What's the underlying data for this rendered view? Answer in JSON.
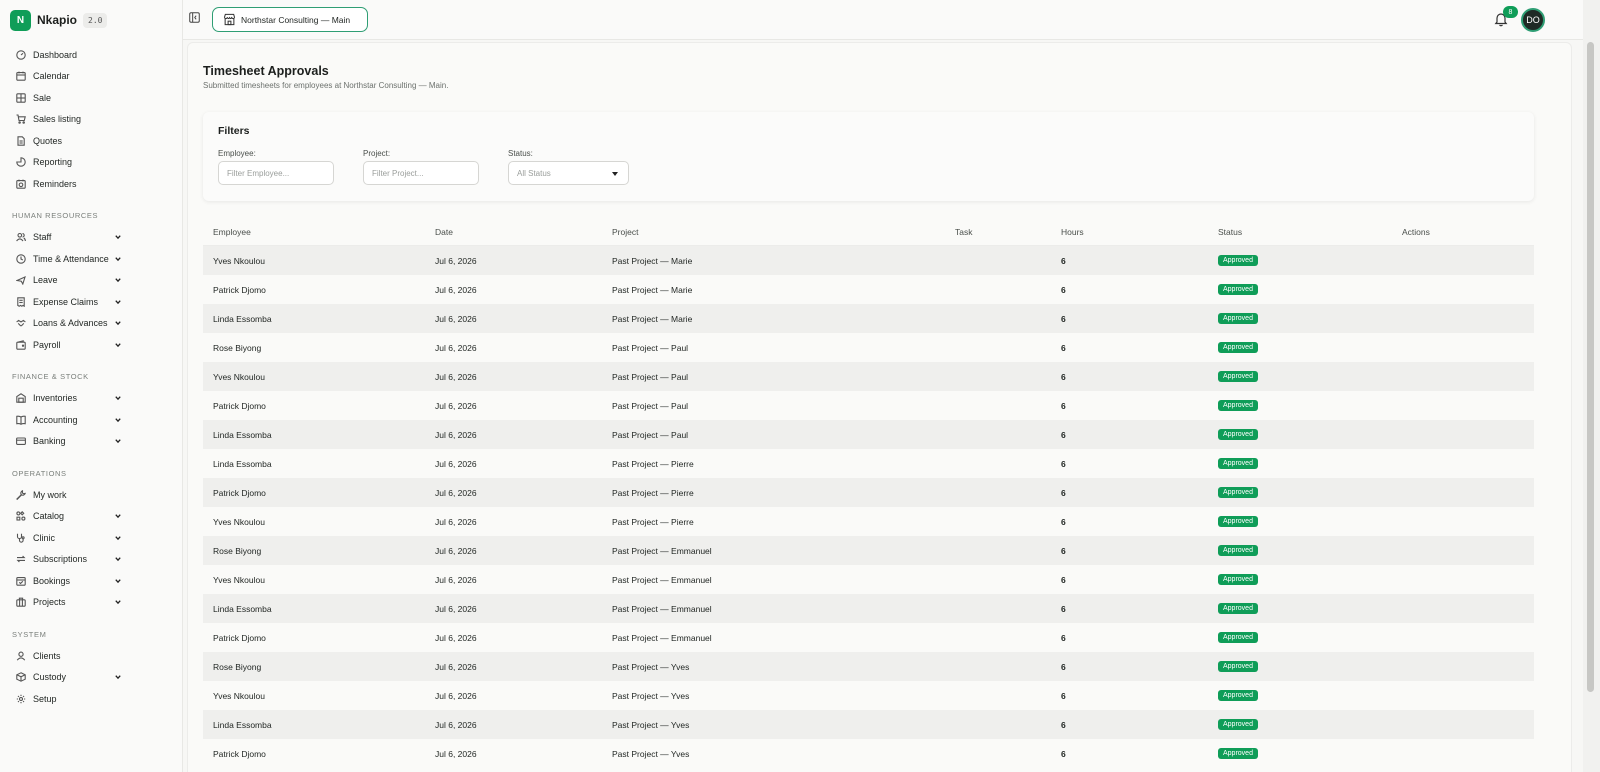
{
  "brand": {
    "logo_letter": "N",
    "name": "Nkapio",
    "version": "2.0"
  },
  "sidebar": {
    "top_items": [
      {
        "label": "Dashboard",
        "icon": "dashboard-icon"
      },
      {
        "label": "Calendar",
        "icon": "calendar-icon"
      },
      {
        "label": "Sale",
        "icon": "grid-icon"
      },
      {
        "label": "Sales listing",
        "icon": "cart-icon"
      },
      {
        "label": "Quotes",
        "icon": "document-icon"
      },
      {
        "label": "Reporting",
        "icon": "pie-chart-icon"
      },
      {
        "label": "Reminders",
        "icon": "reminder-icon"
      }
    ],
    "sections": [
      {
        "title": "HUMAN RESOURCES",
        "items": [
          {
            "label": "Staff",
            "icon": "users-icon"
          },
          {
            "label": "Time & Attendance",
            "icon": "clock-icon"
          },
          {
            "label": "Leave",
            "icon": "plane-icon"
          },
          {
            "label": "Expense Claims",
            "icon": "receipt-icon"
          },
          {
            "label": "Loans & Advances",
            "icon": "handshake-icon"
          },
          {
            "label": "Payroll",
            "icon": "wallet-icon"
          }
        ]
      },
      {
        "title": "FINANCE & STOCK",
        "items": [
          {
            "label": "Inventories",
            "icon": "warehouse-icon"
          },
          {
            "label": "Accounting",
            "icon": "book-icon"
          },
          {
            "label": "Banking",
            "icon": "bank-card-icon"
          }
        ]
      },
      {
        "title": "OPERATIONS",
        "items": [
          {
            "label": "My work",
            "icon": "wrench-icon"
          },
          {
            "label": "Catalog",
            "icon": "catalog-icon"
          },
          {
            "label": "Clinic",
            "icon": "stethoscope-icon"
          },
          {
            "label": "Subscriptions",
            "icon": "repeat-icon"
          },
          {
            "label": "Bookings",
            "icon": "booking-icon"
          },
          {
            "label": "Projects",
            "icon": "briefcase-icon"
          }
        ]
      },
      {
        "title": "SYSTEM",
        "items": [
          {
            "label": "Clients",
            "icon": "user-icon"
          },
          {
            "label": "Custody",
            "icon": "box-icon"
          },
          {
            "label": "Setup",
            "icon": "gear-icon"
          }
        ]
      }
    ]
  },
  "topbar": {
    "org_label": "Northstar Consulting — Main",
    "notification_count": "8",
    "avatar_initials": "DO"
  },
  "page": {
    "title": "Timesheet Approvals",
    "subtitle": "Submitted timesheets for employees at Northstar Consulting — Main."
  },
  "filters": {
    "title": "Filters",
    "employee_label": "Employee:",
    "employee_placeholder": "Filter Employee...",
    "project_label": "Project:",
    "project_placeholder": "Filter Project...",
    "status_label": "Status:",
    "status_value": "All Status"
  },
  "table": {
    "columns": [
      "Employee",
      "Date",
      "Project",
      "Task",
      "Hours",
      "Status",
      "Actions"
    ],
    "rows": [
      {
        "employee": "Yves Nkoulou",
        "date": "Jul 6, 2026",
        "project": "Past Project — Marie",
        "task": "",
        "hours": "6",
        "status": "Approved"
      },
      {
        "employee": "Patrick Djomo",
        "date": "Jul 6, 2026",
        "project": "Past Project — Marie",
        "task": "",
        "hours": "6",
        "status": "Approved"
      },
      {
        "employee": "Linda Essomba",
        "date": "Jul 6, 2026",
        "project": "Past Project — Marie",
        "task": "",
        "hours": "6",
        "status": "Approved"
      },
      {
        "employee": "Rose Biyong",
        "date": "Jul 6, 2026",
        "project": "Past Project — Paul",
        "task": "",
        "hours": "6",
        "status": "Approved"
      },
      {
        "employee": "Yves Nkoulou",
        "date": "Jul 6, 2026",
        "project": "Past Project — Paul",
        "task": "",
        "hours": "6",
        "status": "Approved"
      },
      {
        "employee": "Patrick Djomo",
        "date": "Jul 6, 2026",
        "project": "Past Project — Paul",
        "task": "",
        "hours": "6",
        "status": "Approved"
      },
      {
        "employee": "Linda Essomba",
        "date": "Jul 6, 2026",
        "project": "Past Project — Paul",
        "task": "",
        "hours": "6",
        "status": "Approved"
      },
      {
        "employee": "Linda Essomba",
        "date": "Jul 6, 2026",
        "project": "Past Project — Pierre",
        "task": "",
        "hours": "6",
        "status": "Approved"
      },
      {
        "employee": "Patrick Djomo",
        "date": "Jul 6, 2026",
        "project": "Past Project — Pierre",
        "task": "",
        "hours": "6",
        "status": "Approved"
      },
      {
        "employee": "Yves Nkoulou",
        "date": "Jul 6, 2026",
        "project": "Past Project — Pierre",
        "task": "",
        "hours": "6",
        "status": "Approved"
      },
      {
        "employee": "Rose Biyong",
        "date": "Jul 6, 2026",
        "project": "Past Project — Emmanuel",
        "task": "",
        "hours": "6",
        "status": "Approved"
      },
      {
        "employee": "Yves Nkoulou",
        "date": "Jul 6, 2026",
        "project": "Past Project — Emmanuel",
        "task": "",
        "hours": "6",
        "status": "Approved"
      },
      {
        "employee": "Linda Essomba",
        "date": "Jul 6, 2026",
        "project": "Past Project — Emmanuel",
        "task": "",
        "hours": "6",
        "status": "Approved"
      },
      {
        "employee": "Patrick Djomo",
        "date": "Jul 6, 2026",
        "project": "Past Project — Emmanuel",
        "task": "",
        "hours": "6",
        "status": "Approved"
      },
      {
        "employee": "Rose Biyong",
        "date": "Jul 6, 2026",
        "project": "Past Project — Yves",
        "task": "",
        "hours": "6",
        "status": "Approved"
      },
      {
        "employee": "Yves Nkoulou",
        "date": "Jul 6, 2026",
        "project": "Past Project — Yves",
        "task": "",
        "hours": "6",
        "status": "Approved"
      },
      {
        "employee": "Linda Essomba",
        "date": "Jul 6, 2026",
        "project": "Past Project — Yves",
        "task": "",
        "hours": "6",
        "status": "Approved"
      },
      {
        "employee": "Patrick Djomo",
        "date": "Jul 6, 2026",
        "project": "Past Project — Yves",
        "task": "",
        "hours": "6",
        "status": "Approved"
      }
    ]
  },
  "colors": {
    "brand": "#0f9d58",
    "accent_border": "#2f9e74",
    "status_approved": "#0f9d58"
  }
}
